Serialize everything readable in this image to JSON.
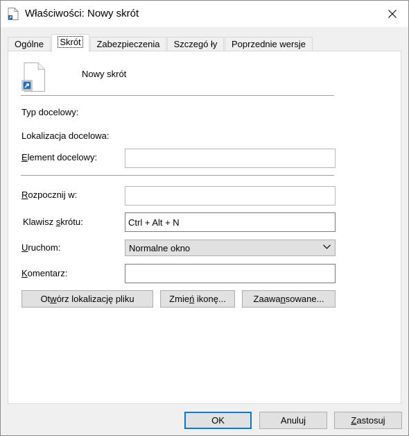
{
  "window": {
    "title": "Właściwości: Nowy skrót"
  },
  "tabs": [
    {
      "label": "Ogólne"
    },
    {
      "label": "Skrót"
    },
    {
      "label": "Zabezpieczenia"
    },
    {
      "label": "Szczegó ły"
    },
    {
      "label": "Poprzednie wersje"
    }
  ],
  "shortcut": {
    "name": "Nowy skrót",
    "target_type_label": "Typ docelowy:",
    "target_location_label": "Lokalizacja docelowa:",
    "target_label_pre": "",
    "target_label_key": "E",
    "target_label_rest": "lement docelowy:",
    "target_value": "",
    "start_in_label_key": "R",
    "start_in_label_rest": "ozpocznij w:",
    "start_in_value": "",
    "hotkey_label_pre": "Klawisz ",
    "hotkey_label_key": "s",
    "hotkey_label_rest": "krótu:",
    "hotkey_value": "Ctrl + Alt + N",
    "run_label_key": "U",
    "run_label_rest": "ruchom:",
    "run_value": "Normalne okno",
    "comment_label_key": "K",
    "comment_label_rest": "omentarz:",
    "comment_value": ""
  },
  "actions": {
    "open_location_pre": "Ot",
    "open_location_key": "w",
    "open_location_rest": "órz lokalizację pliku",
    "change_icon_pre": "Zmie",
    "change_icon_key": "ń",
    "change_icon_rest": " ikonę...",
    "advanced_pre": "Zaawa",
    "advanced_key": "n",
    "advanced_rest": "sowane..."
  },
  "footer": {
    "ok": "OK",
    "cancel": "Anuluj",
    "apply_key": "Z",
    "apply_rest": "astosuj"
  },
  "colors": {
    "focus_border": "#0078d7",
    "button_bg": "#e1e1e1"
  },
  "icons": {
    "title": "shortcut-file-icon",
    "close": "close-icon",
    "file": "shortcut-file-icon",
    "dropdown": "chevron-down-icon"
  }
}
